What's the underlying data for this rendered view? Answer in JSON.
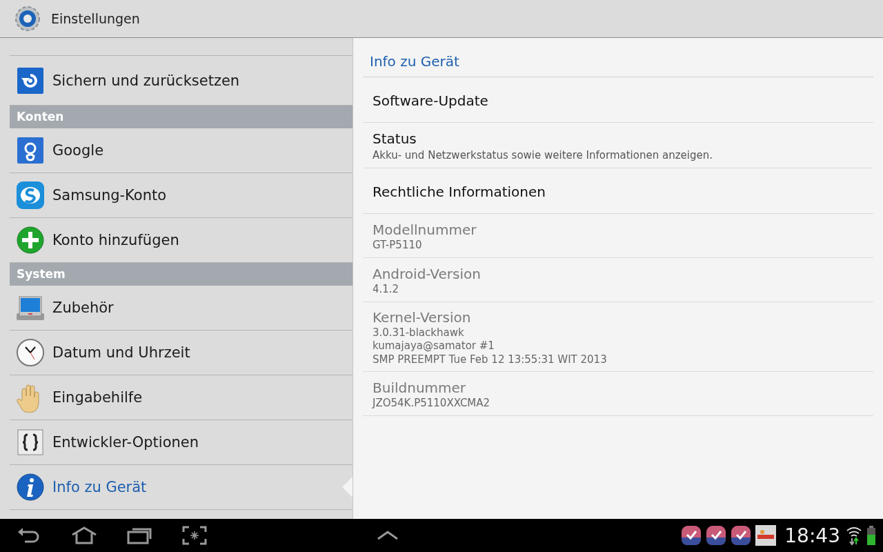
{
  "window": {
    "title": "Einstellungen"
  },
  "sidebar": {
    "items": [
      {
        "kind": "item",
        "label": "Sichern und zurücksetzen",
        "selected": false
      },
      {
        "kind": "header",
        "label": "Konten"
      },
      {
        "kind": "item",
        "label": "Google",
        "selected": false
      },
      {
        "kind": "item",
        "label": "Samsung-Konto",
        "selected": false
      },
      {
        "kind": "item",
        "label": "Konto hinzufügen",
        "selected": false
      },
      {
        "kind": "header",
        "label": "System"
      },
      {
        "kind": "item",
        "label": "Zubehör",
        "selected": false
      },
      {
        "kind": "item",
        "label": "Datum und Uhrzeit",
        "selected": false
      },
      {
        "kind": "item",
        "label": "Eingabehilfe",
        "selected": false
      },
      {
        "kind": "item",
        "label": "Entwickler-Optionen",
        "selected": false
      },
      {
        "kind": "item",
        "label": "Info zu Gerät",
        "selected": true
      }
    ]
  },
  "detail": {
    "title": "Info zu Gerät",
    "entries": [
      {
        "kind": "action",
        "title": "Software-Update"
      },
      {
        "kind": "action",
        "title": "Status",
        "summary": "Akku- und Netzwerkstatus sowie weitere Informationen anzeigen."
      },
      {
        "kind": "action",
        "title": "Rechtliche Informationen"
      },
      {
        "kind": "info",
        "title": "Modellnummer",
        "lines": [
          "GT-P5110"
        ]
      },
      {
        "kind": "info",
        "title": "Android-Version",
        "lines": [
          "4.1.2"
        ]
      },
      {
        "kind": "info",
        "title": "Kernel-Version",
        "lines": [
          "3.0.31-blackhawk",
          "kumajaya@samator #1",
          "SMP PREEMPT Tue Feb 12 13:55:31 WIT 2013"
        ]
      },
      {
        "kind": "info",
        "title": "Buildnummer",
        "lines": [
          "JZO54K.P5110XXCMA2"
        ]
      }
    ]
  },
  "status_bar": {
    "time": "18:43"
  }
}
